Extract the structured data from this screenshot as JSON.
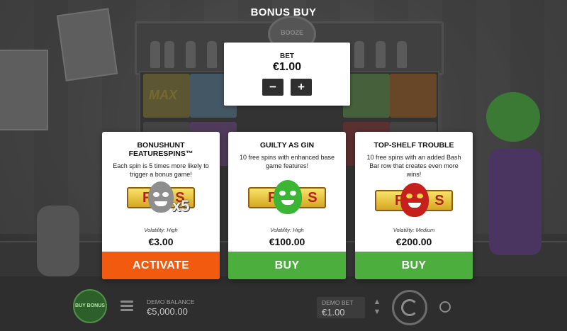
{
  "title": "BONUS BUY",
  "bet": {
    "label": "BET",
    "value": "€1.00",
    "minus": "−",
    "plus": "+"
  },
  "cards": [
    {
      "title": "BONUSHUNT FEATURESPINS™",
      "description": "Each spin is 5 times more likely to trigger a bonus game!",
      "image_letters": "FS",
      "image_multiplier": "x5",
      "volatility": "Volatility: High",
      "price": "€3.00",
      "button": "ACTIVATE",
      "button_color": "#f25a0f",
      "face_color": "#8e8e8e"
    },
    {
      "title": "GUILTY AS GIN",
      "description": "10 free spins with enhanced base game features!",
      "image_letters": "FS",
      "volatility": "Volatility: High",
      "price": "€100.00",
      "button": "BUY",
      "button_color": "#4caf3d",
      "face_color": "#3bb534"
    },
    {
      "title": "TOP-SHELF TROUBLE",
      "description": "10 free spins with an added Bash Bar row that creates even more wins!",
      "image_letters": "FS",
      "volatility": "Volatility: Medium",
      "price": "€200.00",
      "button": "BUY",
      "button_color": "#4caf3d",
      "face_color": "#c5201c"
    }
  ],
  "bottom_bar": {
    "buy_bonus": "BUY BONUS",
    "demo_balance_label": "DEMO BALANCE",
    "demo_balance_value": "€5,000.00",
    "demo_bet_label": "DEMO BET",
    "demo_bet_value": "€1.00"
  },
  "background_text": {
    "max_label": "MAX",
    "logo_label": "BOOZE"
  }
}
